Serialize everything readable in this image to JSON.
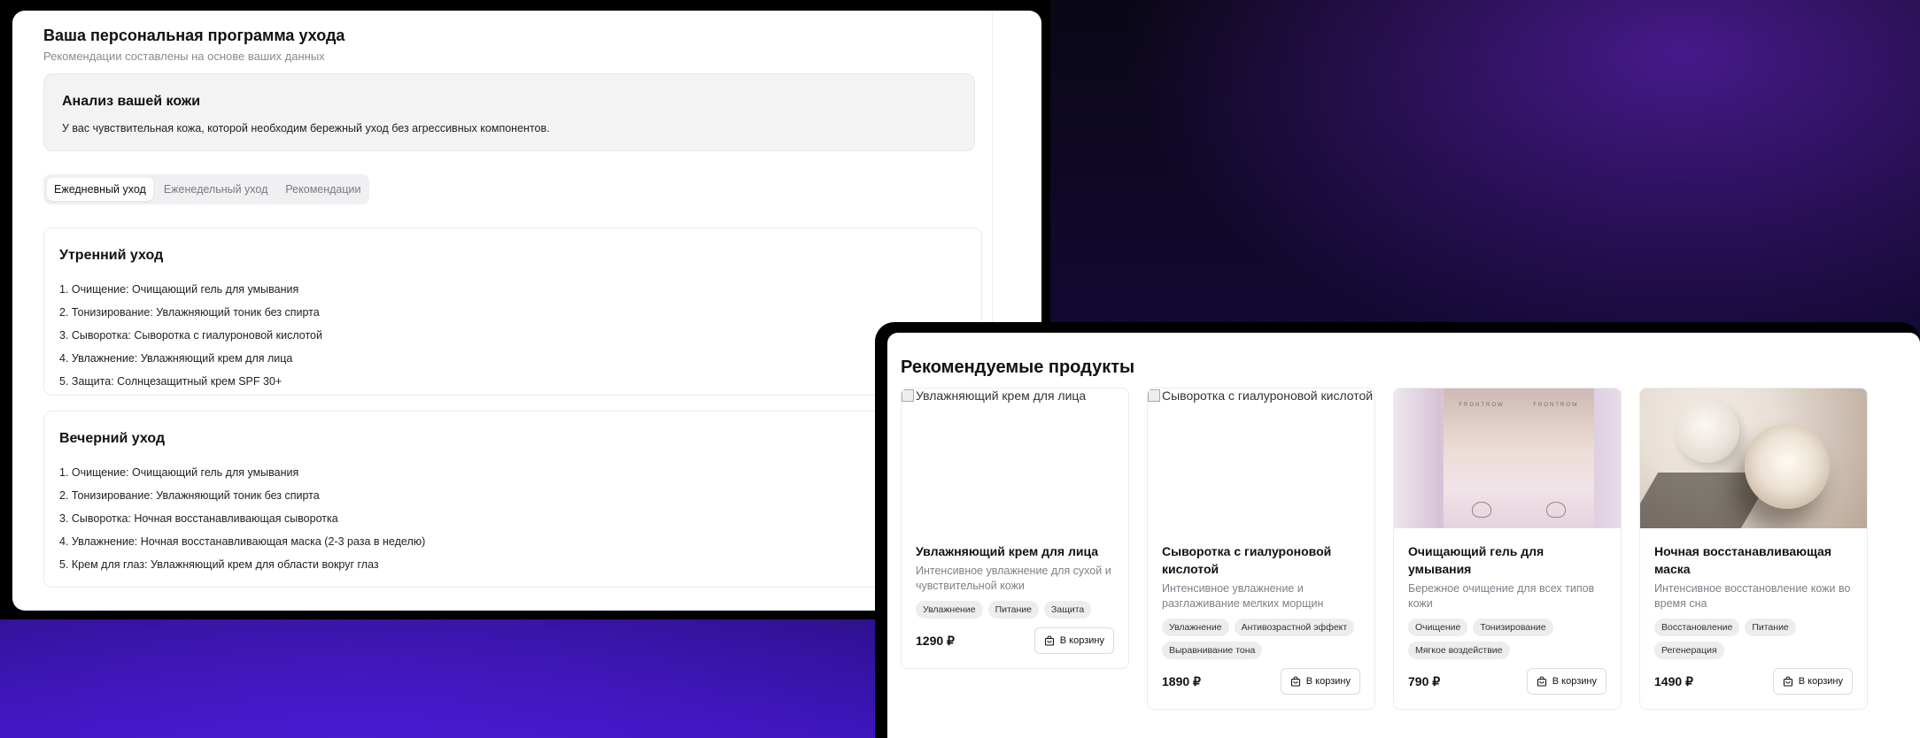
{
  "program": {
    "title": "Ваша персональная программа ухода",
    "subtitle": "Рекомендации составлены на основе ваших данных"
  },
  "analysis": {
    "title": "Анализ вашей кожи",
    "text": "У вас чувствительная кожа, которой необходим бережный уход без агрессивных компонентов."
  },
  "tabs": [
    {
      "label": "Ежедневный уход",
      "active": true
    },
    {
      "label": "Еженедельный уход",
      "active": false
    },
    {
      "label": "Рекомендации",
      "active": false
    }
  ],
  "morning": {
    "title": "Утренний уход",
    "steps": [
      "1. Очищение: Очищающий гель для умывания",
      "2. Тонизирование: Увлажняющий тоник без спирта",
      "3. Сыворотка: Сыворотка с гиалуроновой кислотой",
      "4. Увлажнение: Увлажняющий крем для лица",
      "5. Защита: Солнцезащитный крем SPF 30+"
    ]
  },
  "evening": {
    "title": "Вечерний уход",
    "steps": [
      "1. Очищение: Очищающий гель для умывания",
      "2. Тонизирование: Увлажняющий тоник без спирта",
      "3. Сыворотка: Ночная восстанавливающая сыворотка",
      "4. Увлажнение: Ночная восстанавливающая маска (2-3 раза в неделю)",
      "5. Крем для глаз: Увлажняющий крем для области вокруг глаз"
    ]
  },
  "products": {
    "title": "Рекомендуемые продукты",
    "cart_label": "В корзину",
    "items": [
      {
        "name": "Увлажняющий крем для лица",
        "alt": "Увлажняющий крем для лица",
        "image_loaded": false,
        "desc": "Интенсивное увлажнение для сухой и чувствительной кожи",
        "tags": [
          "Увлажнение",
          "Питание",
          "Защита"
        ],
        "price": "1290 ₽"
      },
      {
        "name": "Сыворотка с гиалуроновой кислотой",
        "alt": "Сыворотка с гиалуроновой кислотой",
        "image_loaded": false,
        "desc": "Интенсивное увлажнение и разглаживание мелких морщин",
        "tags": [
          "Увлажнение",
          "Антивозрастной эффект",
          "Выравнивание тона"
        ],
        "price": "1890 ₽"
      },
      {
        "name": "Очищающий гель для умывания",
        "alt": "Очищающий гель для умывания",
        "image_loaded": true,
        "image_text": "FRONTROW",
        "desc": "Бережное очищение для всех типов кожи",
        "tags": [
          "Очищение",
          "Тонизирование",
          "Мягкое воздействие"
        ],
        "price": "790 ₽"
      },
      {
        "name": "Ночная восстанавливающая маска",
        "alt": "Ночная восстанавливающая маска",
        "image_loaded": true,
        "desc": "Интенсивное восстановление кожи во время сна",
        "tags": [
          "Восстановление",
          "Питание",
          "Регенерация"
        ],
        "price": "1490 ₽"
      }
    ]
  }
}
